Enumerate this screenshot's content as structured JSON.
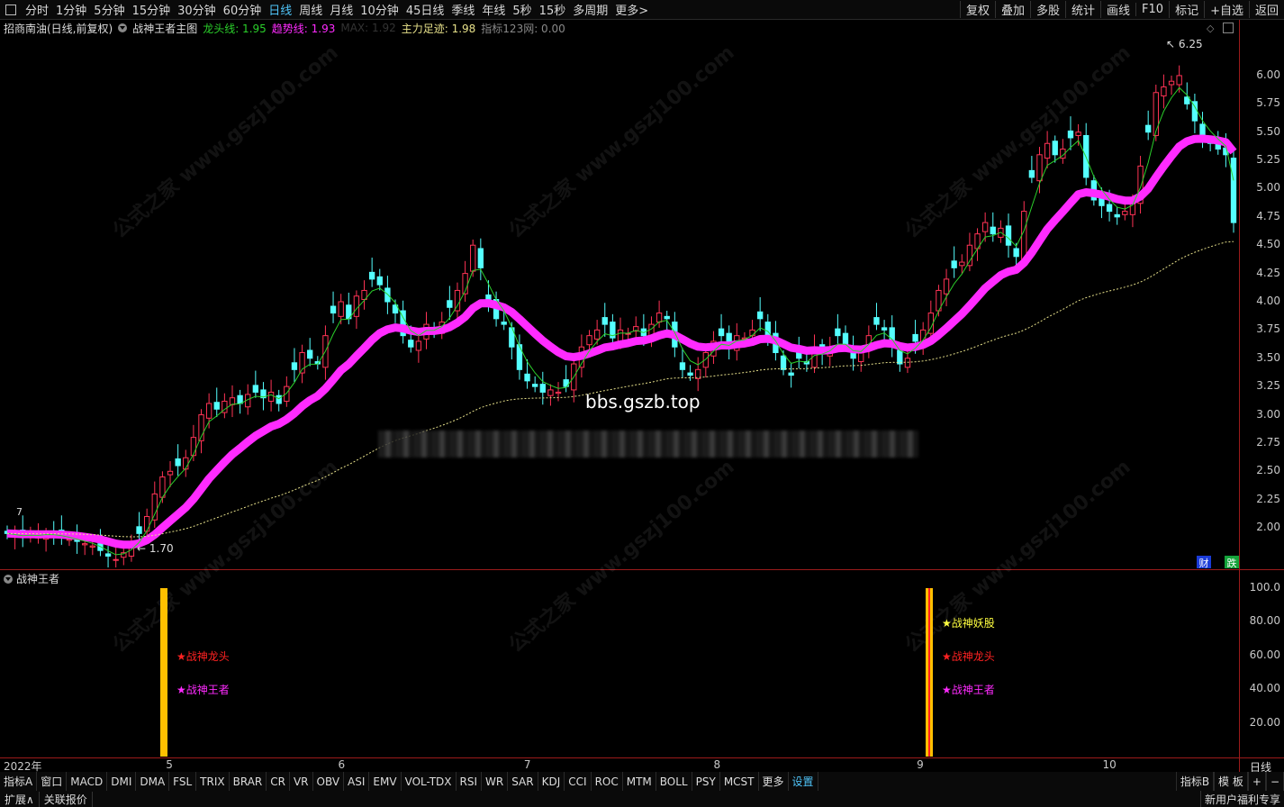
{
  "topbar": {
    "periods": [
      "分时",
      "1分钟",
      "5分钟",
      "15分钟",
      "30分钟",
      "60分钟",
      "日线",
      "周线",
      "月线",
      "10分钟",
      "45日线",
      "季线",
      "年线",
      "5秒",
      "15秒",
      "多周期",
      "更多>"
    ],
    "active_period": "日线",
    "right_tools": [
      "复权",
      "叠加",
      "多股",
      "统计",
      "画线",
      "F10",
      "标记",
      "+自选",
      "返回"
    ]
  },
  "infobar": {
    "stock": "招商南油(日线,前复权)",
    "indicator_name": "战神王者主图",
    "dragon_line": "龙头线: 1.95",
    "trend_line": "趋势线: 1.93",
    "max_line": "MAX: 1.92",
    "main_force": "主力足迹: 1.98",
    "index123": "指标123网: 0.00"
  },
  "colors": {
    "up": "#ff3355",
    "down": "#54ffff",
    "trend": "#ff2bff",
    "dragon": "#2bd02b",
    "ma": "#e6e08a",
    "border": "#9b1b1b",
    "gold": "#ffc000"
  },
  "main_yaxis": [
    "6.00",
    "5.75",
    "5.50",
    "5.25",
    "5.00",
    "4.75",
    "4.50",
    "4.25",
    "4.00",
    "3.75",
    "3.50",
    "3.25",
    "3.00",
    "2.75",
    "2.50",
    "2.25",
    "2.00"
  ],
  "ind_yaxis": [
    "100.0",
    "80.00",
    "60.00",
    "40.00",
    "20.00"
  ],
  "annotations": {
    "high": "6.25",
    "low": "1.70",
    "left_label": "7",
    "watermark_site": "bbs.gszb.top",
    "side_icon_1": "财",
    "side_icon_2": "跌"
  },
  "indicator": {
    "title": "战神王者",
    "signals_left": [
      {
        "label": "战神龙头"
      },
      {
        "label": "战神王者"
      }
    ],
    "signals_right": [
      {
        "label": "战神妖股"
      },
      {
        "label": "战神龙头"
      },
      {
        "label": "战神王者"
      }
    ]
  },
  "xaxis": {
    "labels": [
      "2022年",
      "5",
      "6",
      "7",
      "8",
      "9",
      "10"
    ],
    "period": "日线"
  },
  "bottom_tabs": [
    "指标A",
    "窗口",
    "MACD",
    "DMI",
    "DMA",
    "FSL",
    "TRIX",
    "BRAR",
    "CR",
    "VR",
    "OBV",
    "ASI",
    "EMV",
    "VOL-TDX",
    "RSI",
    "WR",
    "SAR",
    "KDJ",
    "CCI",
    "ROC",
    "MTM",
    "BOLL",
    "PSY",
    "MCST",
    "更多",
    "设置"
  ],
  "bottom_right_tabs": [
    "指标B",
    "模 板",
    "+",
    "−"
  ],
  "bottom_row2": [
    "扩展∧",
    "关联报价"
  ],
  "bottom_row2_right": "新用户福利专享",
  "chart_data": {
    "type": "candlestick",
    "title": "招商南油(日线,前复权)",
    "ylim": [
      1.65,
      6.35
    ],
    "closes": [
      1.95,
      1.93,
      1.92,
      1.94,
      1.93,
      1.95,
      1.94,
      1.92,
      1.9,
      1.88,
      1.86,
      1.84,
      1.8,
      1.75,
      1.72,
      1.78,
      1.85,
      1.95,
      2.1,
      2.3,
      2.45,
      2.5,
      2.55,
      2.62,
      2.8,
      3.0,
      3.1,
      3.05,
      3.12,
      3.15,
      3.1,
      3.18,
      3.2,
      3.15,
      3.2,
      3.1,
      3.25,
      3.4,
      3.55,
      3.5,
      3.45,
      3.7,
      3.9,
      4.0,
      3.85,
      4.05,
      4.1,
      4.2,
      4.15,
      4.0,
      3.9,
      3.7,
      3.6,
      3.65,
      3.8,
      3.75,
      3.82,
      3.95,
      4.1,
      4.25,
      4.5,
      4.3,
      4.0,
      3.85,
      3.8,
      3.6,
      3.4,
      3.3,
      3.25,
      3.2,
      3.22,
      3.2,
      3.25,
      3.45,
      3.6,
      3.7,
      3.75,
      3.8,
      3.68,
      3.75,
      3.72,
      3.78,
      3.7,
      3.8,
      3.9,
      3.85,
      3.6,
      3.4,
      3.35,
      3.4,
      3.55,
      3.65,
      3.7,
      3.6,
      3.7,
      3.68,
      3.75,
      3.85,
      3.7,
      3.55,
      3.4,
      3.35,
      3.5,
      3.45,
      3.6,
      3.55,
      3.6,
      3.7,
      3.62,
      3.5,
      3.55,
      3.7,
      3.8,
      3.75,
      3.6,
      3.45,
      3.5,
      3.65,
      3.75,
      3.9,
      4.1,
      4.2,
      4.3,
      4.35,
      4.5,
      4.6,
      4.7,
      4.6,
      4.65,
      4.5,
      4.4,
      4.8,
      5.1,
      5.3,
      5.4,
      5.3,
      5.35,
      5.45,
      5.5,
      5.1,
      4.9,
      4.85,
      4.8,
      4.75,
      4.8,
      4.9,
      5.2,
      5.5,
      5.85,
      5.9,
      5.95,
      6.0,
      5.75,
      5.6,
      5.45,
      5.4,
      5.35,
      5.3,
      4.7
    ],
    "series": [
      {
        "name": "龙头线",
        "values": [
          1.95
        ]
      },
      {
        "name": "趋势线",
        "values": [
          1.93
        ]
      },
      {
        "name": "主力足迹",
        "values": [
          1.98
        ]
      }
    ]
  }
}
